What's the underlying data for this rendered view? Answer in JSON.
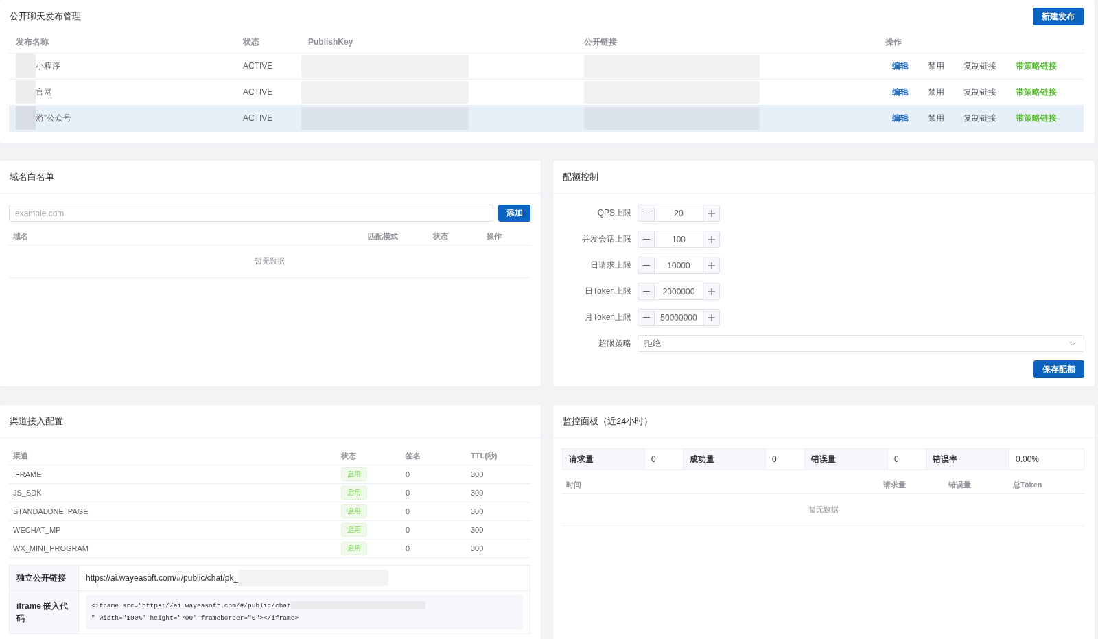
{
  "publish_panel": {
    "title": "公开聊天发布管理",
    "new_button": "新建发布",
    "columns": [
      "发布名称",
      "状态",
      "PublishKey",
      "公开链接",
      "操作"
    ],
    "rows": [
      {
        "name": "小程序",
        "status": "ACTIVE",
        "selected": false,
        "actions": [
          {
            "label": "编辑",
            "kind": "primary"
          },
          {
            "label": "禁用",
            "kind": "plain"
          },
          {
            "label": "复制链接",
            "kind": "plain"
          },
          {
            "label": "带策略链接",
            "kind": "success"
          }
        ]
      },
      {
        "name": "官网",
        "status": "ACTIVE",
        "selected": false,
        "actions": [
          {
            "label": "编辑",
            "kind": "primary"
          },
          {
            "label": "禁用",
            "kind": "plain"
          },
          {
            "label": "复制链接",
            "kind": "plain"
          },
          {
            "label": "带策略链接",
            "kind": "success"
          }
        ]
      },
      {
        "name": "游”公众号",
        "status": "ACTIVE",
        "selected": true,
        "actions": [
          {
            "label": "编辑",
            "kind": "primary"
          },
          {
            "label": "禁用",
            "kind": "plain"
          },
          {
            "label": "复制链接",
            "kind": "plain"
          },
          {
            "label": "带策略链接",
            "kind": "success"
          }
        ]
      }
    ]
  },
  "whitelist_panel": {
    "title": "域名白名单",
    "input": {
      "placeholder": "example.com"
    },
    "add_button": "添加",
    "columns": [
      "域名",
      "匹配模式",
      "状态",
      "操作"
    ],
    "empty_text": "暂无数据"
  },
  "quota_panel": {
    "title": "配额控制",
    "fields": [
      {
        "label": "QPS上限",
        "kind": "stepper",
        "value": "20"
      },
      {
        "label": "并发会话上限",
        "kind": "stepper",
        "value": "100"
      },
      {
        "label": "日请求上限",
        "kind": "stepper",
        "value": "10000"
      },
      {
        "label": "日Token上限",
        "kind": "stepper",
        "value": "2000000"
      },
      {
        "label": "月Token上限",
        "kind": "stepper",
        "value": "50000000"
      },
      {
        "label": "超限策略",
        "kind": "select",
        "value": "拒绝"
      }
    ],
    "save_button": "保存配额"
  },
  "channel_panel": {
    "title": "渠道接入配置",
    "columns": [
      "渠道",
      "状态",
      "签名",
      "TTL(秒)"
    ],
    "rows": [
      {
        "channel": "IFRAME",
        "status": "启用",
        "signature": "0",
        "ttl": "300"
      },
      {
        "channel": "JS_SDK",
        "status": "启用",
        "signature": "0",
        "ttl": "300"
      },
      {
        "channel": "STANDALONE_PAGE",
        "status": "启用",
        "signature": "0",
        "ttl": "300"
      },
      {
        "channel": "WECHAT_MP",
        "status": "启用",
        "signature": "0",
        "ttl": "300"
      },
      {
        "channel": "WX_MINI_PROGRAM",
        "status": "启用",
        "signature": "0",
        "ttl": "300"
      }
    ],
    "details": [
      {
        "label": "独立公开链接",
        "kind": "link",
        "value": "https://ai.wayeasoft.com/#/public/chat/pk_"
      },
      {
        "label": "iframe 嵌入代码",
        "kind": "code",
        "code_start": "<iframe src=\"https://ai.wayeasoft.com/#/public/chat",
        "code_end": "\" width=\"100%\" height=\"700\" frameborder=\"0\"></iframe>"
      }
    ]
  },
  "monitor_panel": {
    "title": "监控面板（近24小时）",
    "stats": [
      {
        "label": "请求量",
        "value": "0"
      },
      {
        "label": "成功量",
        "value": "0"
      },
      {
        "label": "错误量",
        "value": "0"
      },
      {
        "label": "错误率",
        "value": "0.00%"
      }
    ],
    "columns": [
      "时间",
      "请求量",
      "错误量",
      "总Token"
    ],
    "empty_text": "暂无数据"
  }
}
